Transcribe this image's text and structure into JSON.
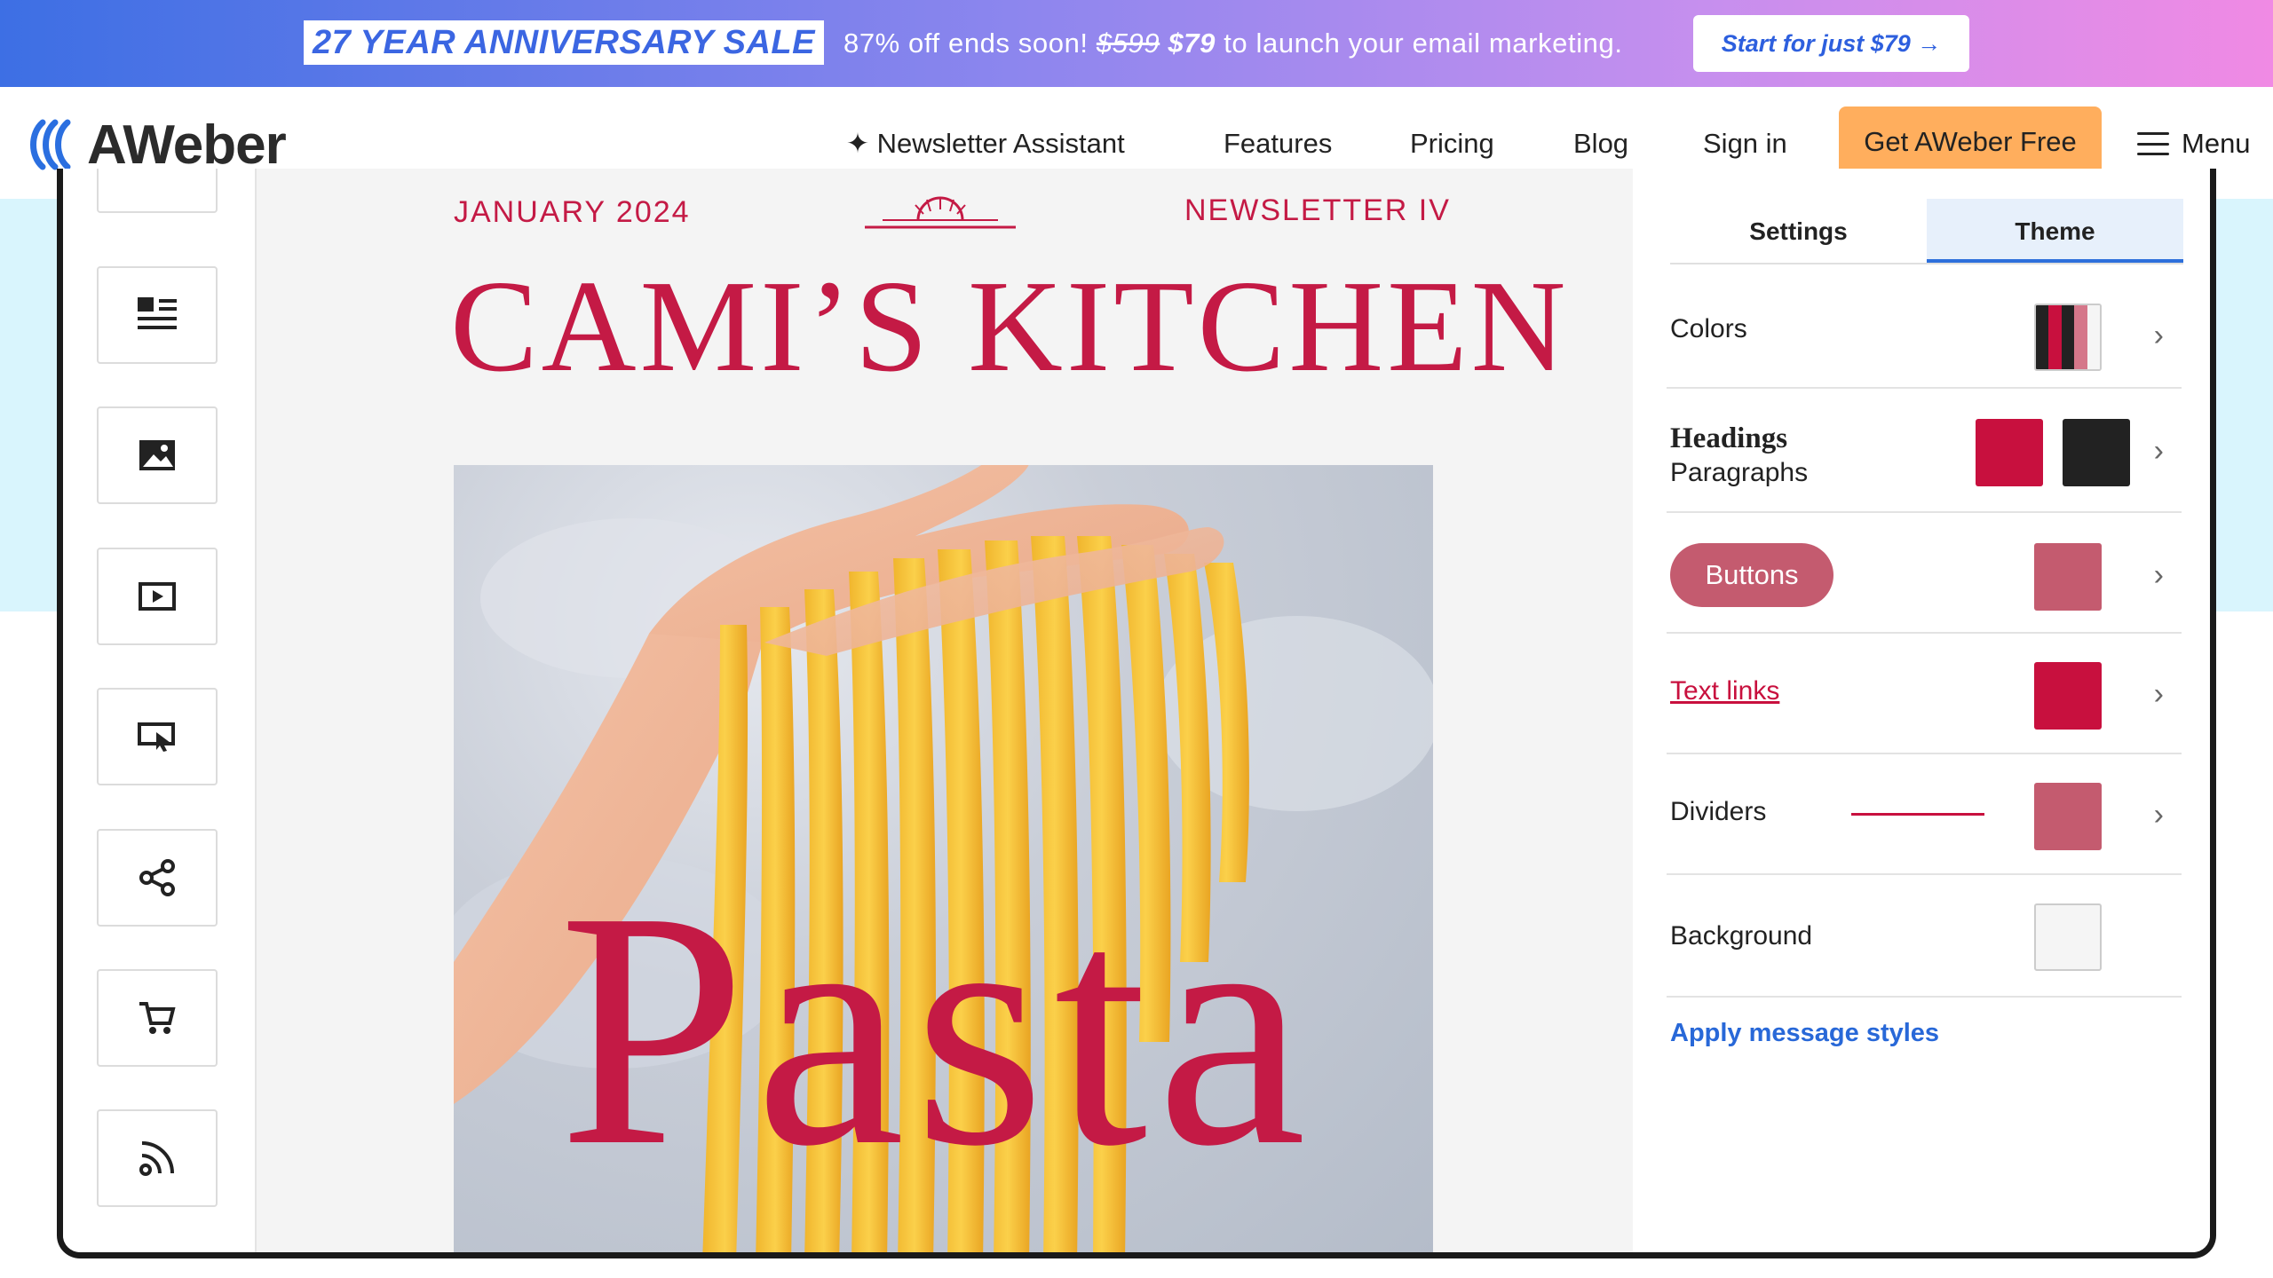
{
  "promo": {
    "tag": "27 YEAR ANNIVERSARY SALE",
    "message_prefix": "87% off ends soon!",
    "old_price": "$599",
    "new_price": "$79",
    "message_suffix": "to launch your email marketing.",
    "cta": "Start for just $79 →"
  },
  "nav": {
    "logo": "AWeber",
    "items": [
      "✦ Newsletter Assistant",
      "Features",
      "Pricing",
      "Blog",
      "Sign in"
    ],
    "cta": "Get AWeber Free",
    "menu": "Menu"
  },
  "toolbar": {
    "icons": [
      "text-block-icon",
      "image-icon",
      "video-icon",
      "button-icon",
      "share-icon",
      "cart-icon",
      "rss-icon"
    ]
  },
  "newsletter": {
    "date": "JANUARY 2024",
    "issue": "NEWSLETTER IV",
    "title": "CAMI’S KITCHEN",
    "hero_word": "Pasta"
  },
  "panel": {
    "tabs": [
      "Settings",
      "Theme"
    ],
    "active_tab": "Theme",
    "colors_label": "Colors",
    "headings_label": "Headings",
    "paragraphs_label": "Paragraphs",
    "buttons_label": "Buttons",
    "text_links_label": "Text links",
    "dividers_label": "Dividers",
    "background_label": "Background",
    "apply": "Apply message styles",
    "swatches": {
      "headings": "#c8103e",
      "paragraphs": "#222222",
      "buttons": "#c45b6f",
      "text_links": "#c8103e",
      "dividers": "#c45b6f",
      "background": "#f5f5f5"
    }
  }
}
